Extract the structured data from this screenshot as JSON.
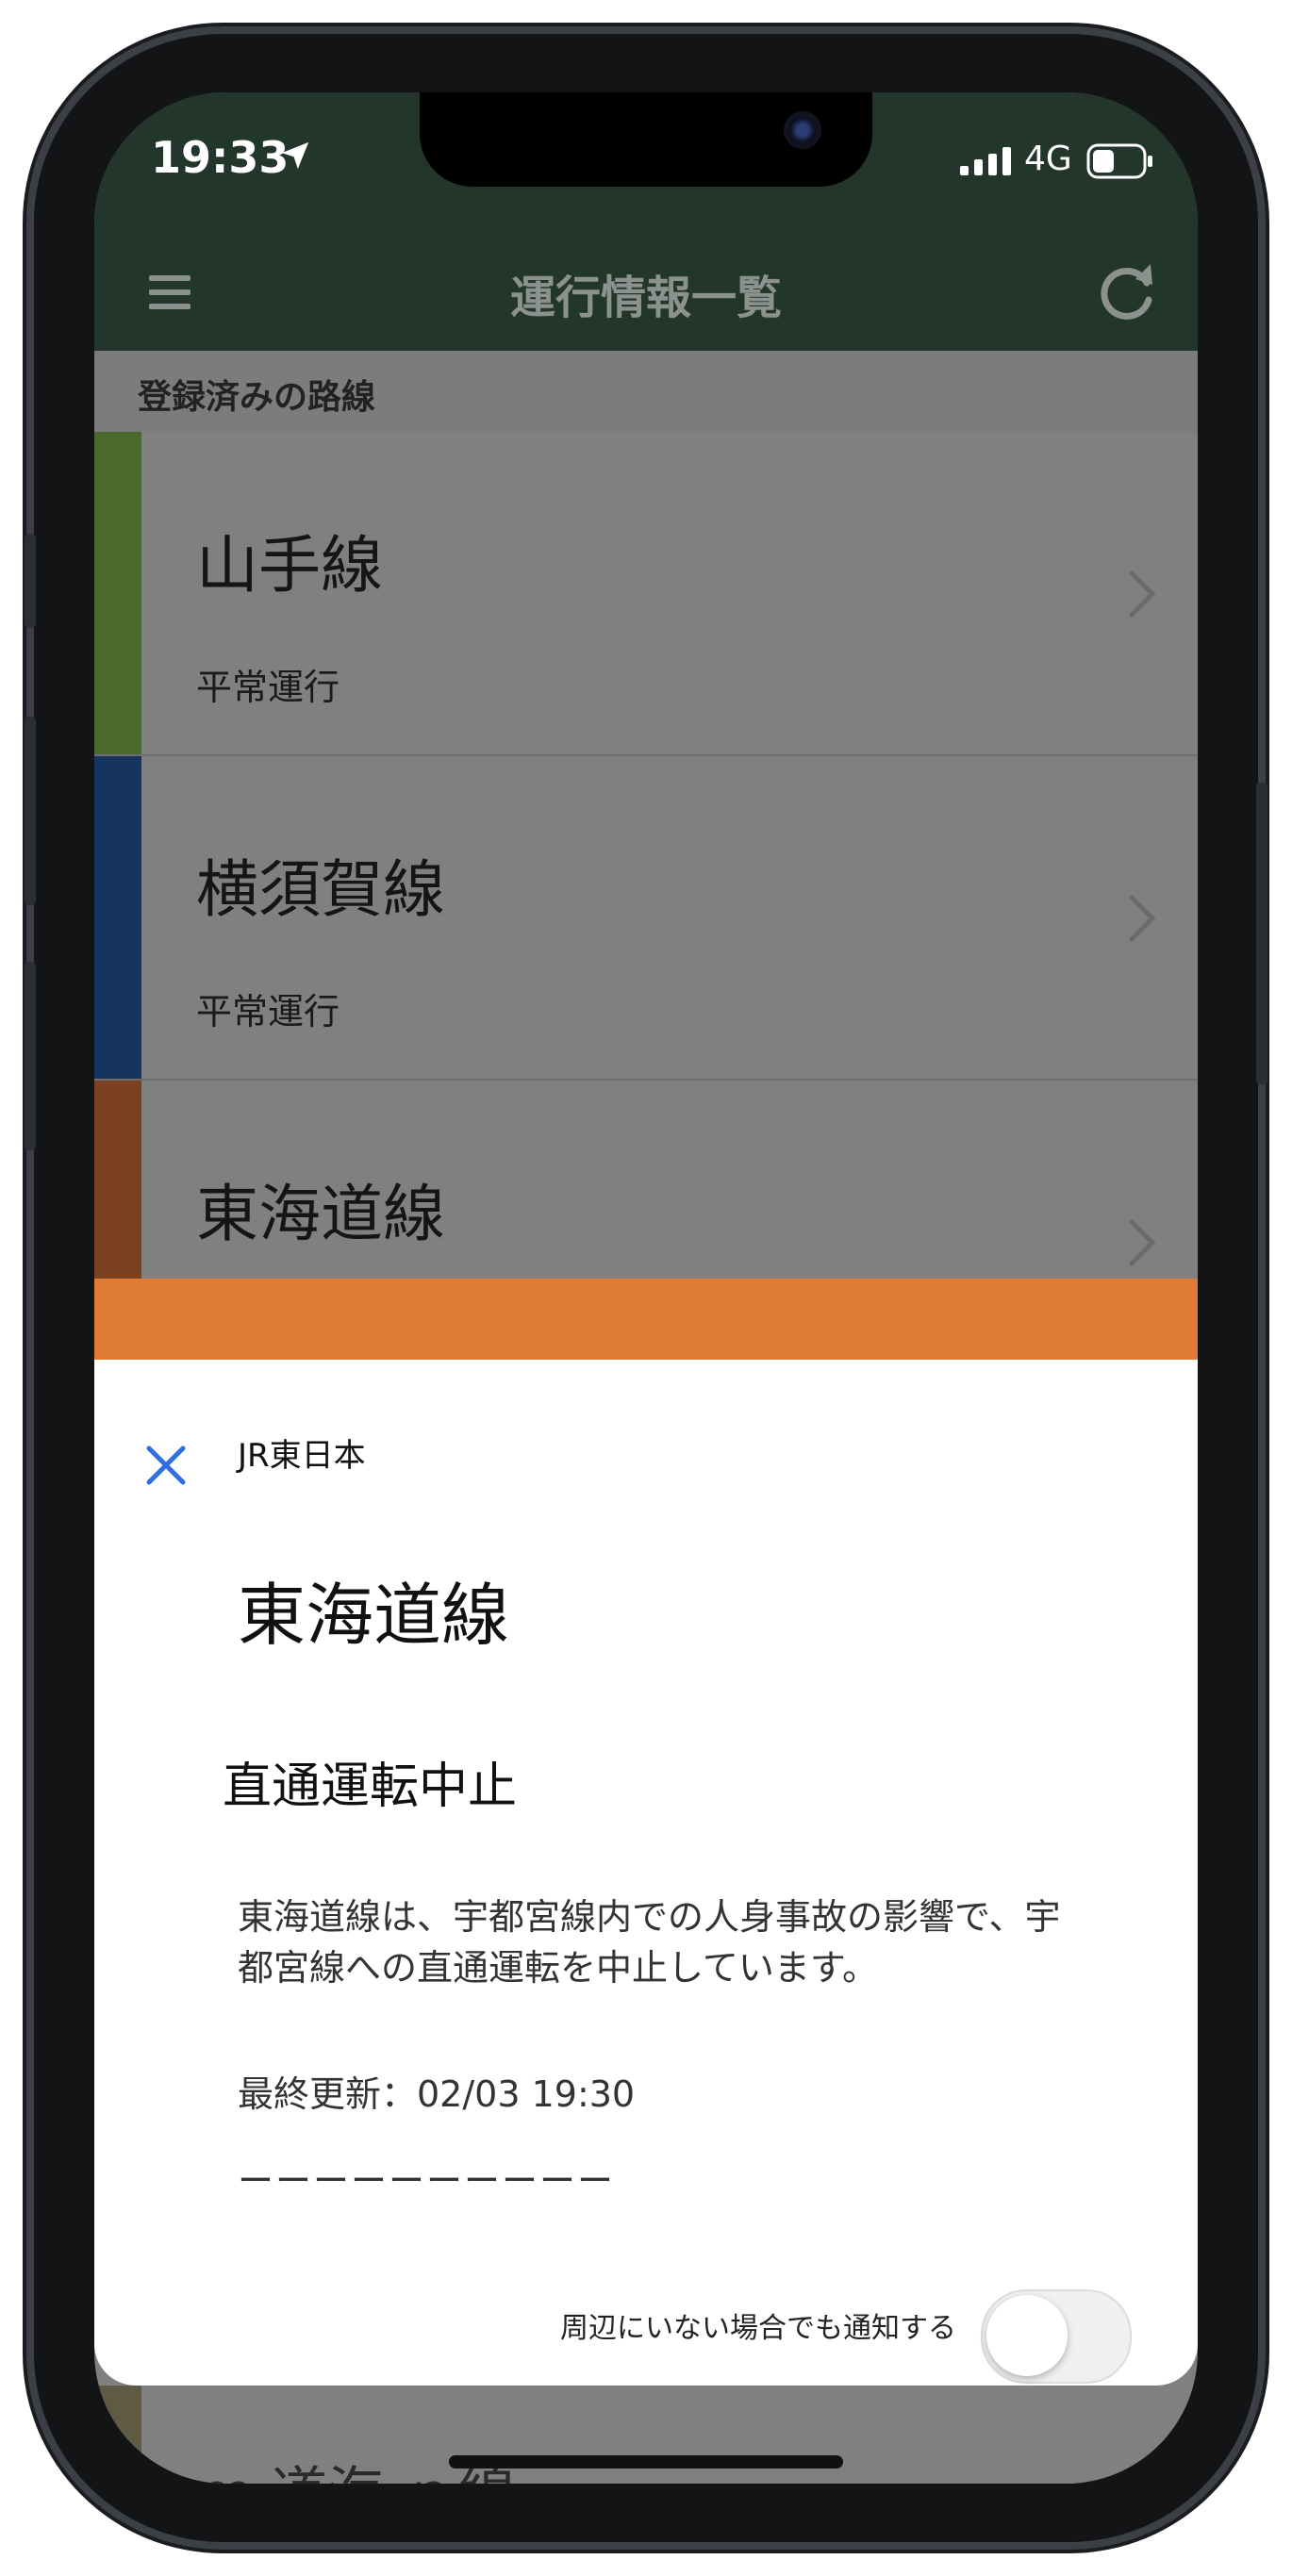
{
  "status_bar": {
    "time": "19:33",
    "network": "4G"
  },
  "nav": {
    "title": "運行情報一覧"
  },
  "section": {
    "header": "登録済みの路線"
  },
  "lines": [
    {
      "name": "山手線",
      "status": "平常運行",
      "color": "#4a6a2c"
    },
    {
      "name": "横須賀線",
      "status": "平常運行",
      "color": "#15345e"
    },
    {
      "name": "東海道線",
      "status": "",
      "color": "#7a4220"
    }
  ],
  "sheet": {
    "accent_color": "#e07b36",
    "company": "JR東日本",
    "title": "東海道線",
    "status": "直通運転中止",
    "detail": "東海道線は、宇都宮線内での人身事故の影響で、宇都宮線への直通運転を中止しています。",
    "updated": "最終更新：02/03 19:30",
    "divider": "ーーーーーーーーーー",
    "toggle_label": "周辺にいない場合でも通知する",
    "toggle_on": false
  },
  "peek": {
    "text": "ｍ 道海 ｎ線"
  }
}
